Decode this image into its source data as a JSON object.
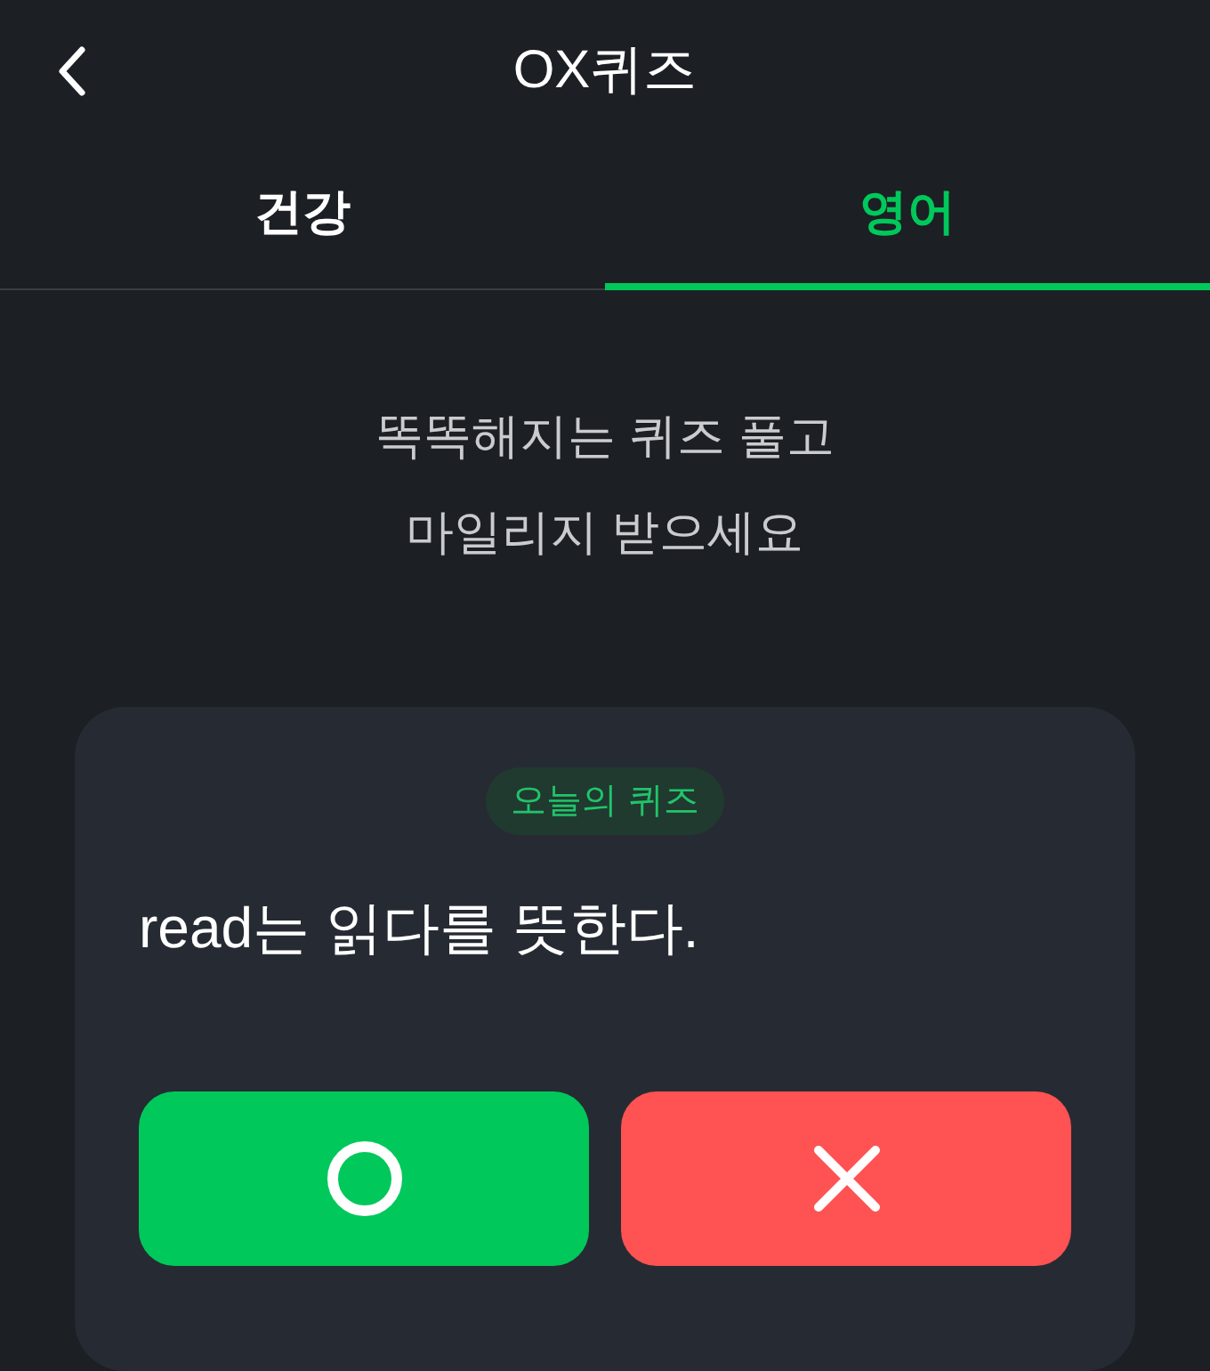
{
  "header": {
    "title": "OX퀴즈"
  },
  "tabs": [
    {
      "label": "건강",
      "selected": false
    },
    {
      "label": "영어",
      "selected": true
    }
  ],
  "subtitle": [
    "똑똑해지는 퀴즈 풀고",
    "마일리지 받으세요"
  ],
  "quiz": {
    "badge": "오늘의 퀴즈",
    "question": "read는 읽다를 뜻한다.",
    "answers": [
      {
        "kind": "o"
      },
      {
        "kind": "x"
      }
    ]
  }
}
